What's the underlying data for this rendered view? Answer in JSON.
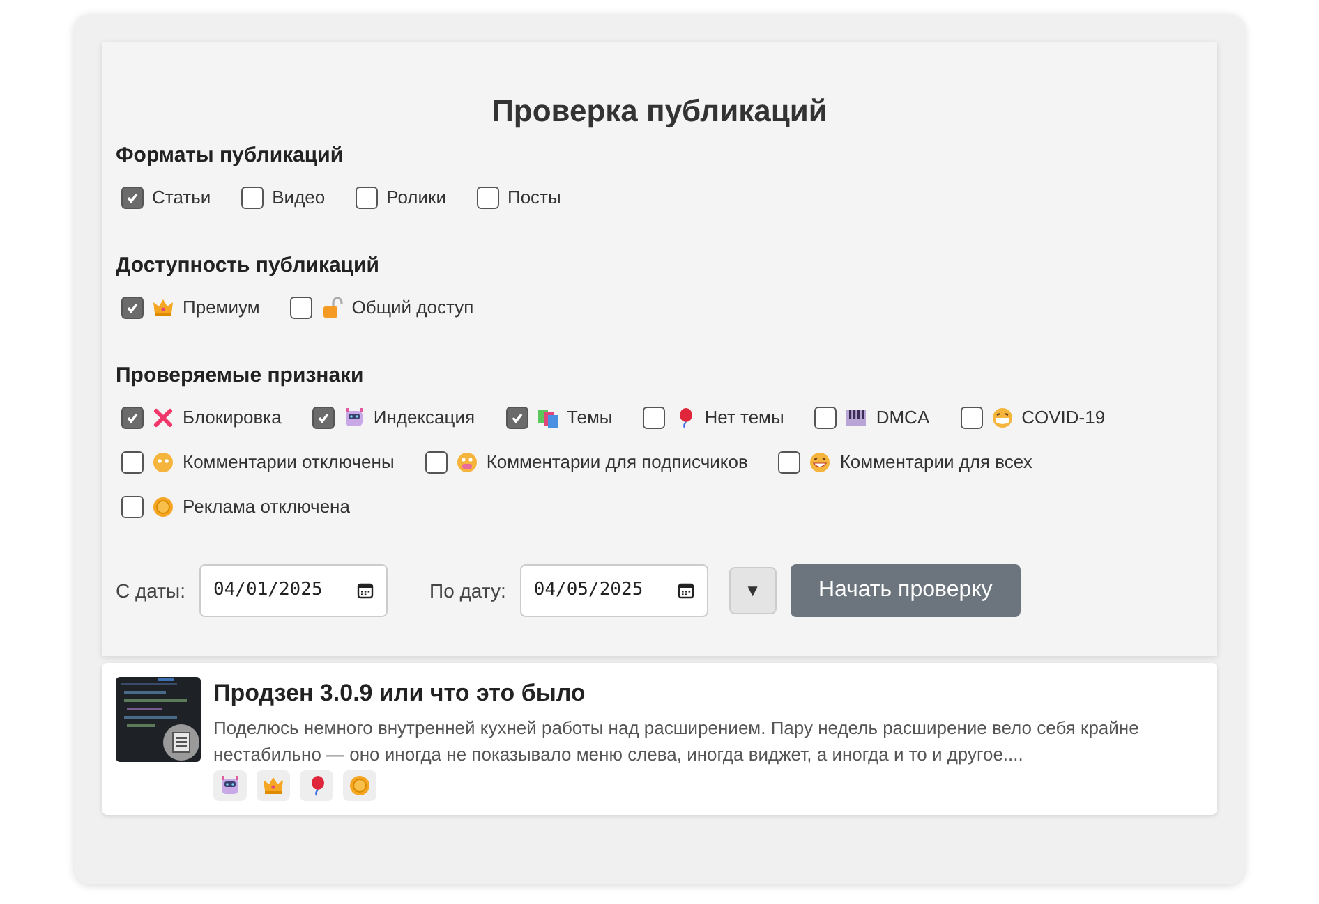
{
  "title": "Проверка публикаций",
  "sections": [
    {
      "heading": "Форматы публикаций",
      "options": [
        {
          "label": "Статьи",
          "checked": true
        },
        {
          "label": "Видео",
          "checked": false
        },
        {
          "label": "Ролики",
          "checked": false
        },
        {
          "label": "Посты",
          "checked": false
        }
      ]
    },
    {
      "heading": "Доступность публикаций",
      "options": [
        {
          "label": "Премиум",
          "checked": true,
          "kind": "crown"
        },
        {
          "label": "Общий доступ",
          "checked": false,
          "kind": "lock"
        }
      ]
    },
    {
      "heading": "Проверяемые признаки",
      "options": [
        {
          "label": "Блокировка",
          "checked": true,
          "kind": "cross"
        },
        {
          "label": "Индексация",
          "checked": true,
          "kind": "robot"
        },
        {
          "label": "Темы",
          "checked": true,
          "kind": "books"
        },
        {
          "label": "Нет темы",
          "checked": false,
          "kind": "balloon"
        },
        {
          "label": "DMCA",
          "checked": false,
          "kind": "piano"
        },
        {
          "label": "COVID-19",
          "checked": false,
          "kind": "mask"
        },
        {
          "label": "Комментарии отключены",
          "checked": false,
          "kind": "face"
        },
        {
          "label": "Комментарии для подписчиков",
          "checked": false,
          "kind": "grimace"
        },
        {
          "label": "Комментарии для всех",
          "checked": false,
          "kind": "grin"
        },
        {
          "label": "Реклама отключена",
          "checked": false,
          "kind": "coin"
        }
      ]
    }
  ],
  "from": {
    "label": "С даты:",
    "value": "04/01/2025"
  },
  "to": {
    "label": "По дату:",
    "value": "04/05/2025"
  },
  "toggle": "▼",
  "start_button": "Начать проверку",
  "results": [
    {
      "title": "Продзен 3.0.9 или что это было",
      "text": "Поделюсь немного внутренней кухней работы над расширением. Пару недель расширение вело себя крайне нестабильно — оно иногда не показывало меню слева, иногда виджет, а иногда и то и другое....",
      "tags": [
        {
          "kind": "robot"
        },
        {
          "kind": "crown"
        },
        {
          "kind": "balloon"
        },
        {
          "kind": "coin"
        }
      ]
    }
  ]
}
